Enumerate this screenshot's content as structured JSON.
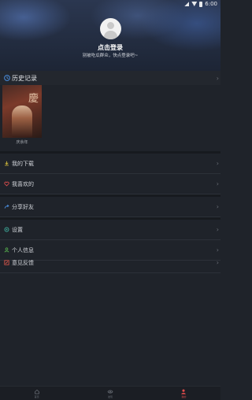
{
  "status": {
    "time": "6:00"
  },
  "header": {
    "title": "点击登录",
    "subtitle": "别被吃瓜群众，快点登录吧~"
  },
  "history": {
    "label": "历史记录",
    "items": [
      {
        "title": "庆余年"
      }
    ]
  },
  "menu_group1": [
    {
      "label": "我的下载",
      "icon": "download-icon",
      "color": "#c8b23a"
    },
    {
      "label": "我喜欢的",
      "icon": "heart-icon",
      "color": "#e04e4e"
    }
  ],
  "menu_group2": [
    {
      "label": "分享好友",
      "icon": "share-icon",
      "color": "#4b8fe0"
    }
  ],
  "menu_group3": [
    {
      "label": "设置",
      "icon": "settings-icon",
      "color": "#3fb2a0"
    },
    {
      "label": "个人信息",
      "icon": "person-icon",
      "color": "#58b54f"
    },
    {
      "label": "意见反馈",
      "icon": "feedback-icon",
      "color": "#e0574b"
    }
  ],
  "navbar": {
    "items": [
      {
        "label": "首页",
        "icon": "home-icon"
      },
      {
        "label": "发现",
        "icon": "eye-icon"
      },
      {
        "label": "我的",
        "icon": "profile-icon"
      }
    ],
    "active_color": "#e24c4c"
  }
}
